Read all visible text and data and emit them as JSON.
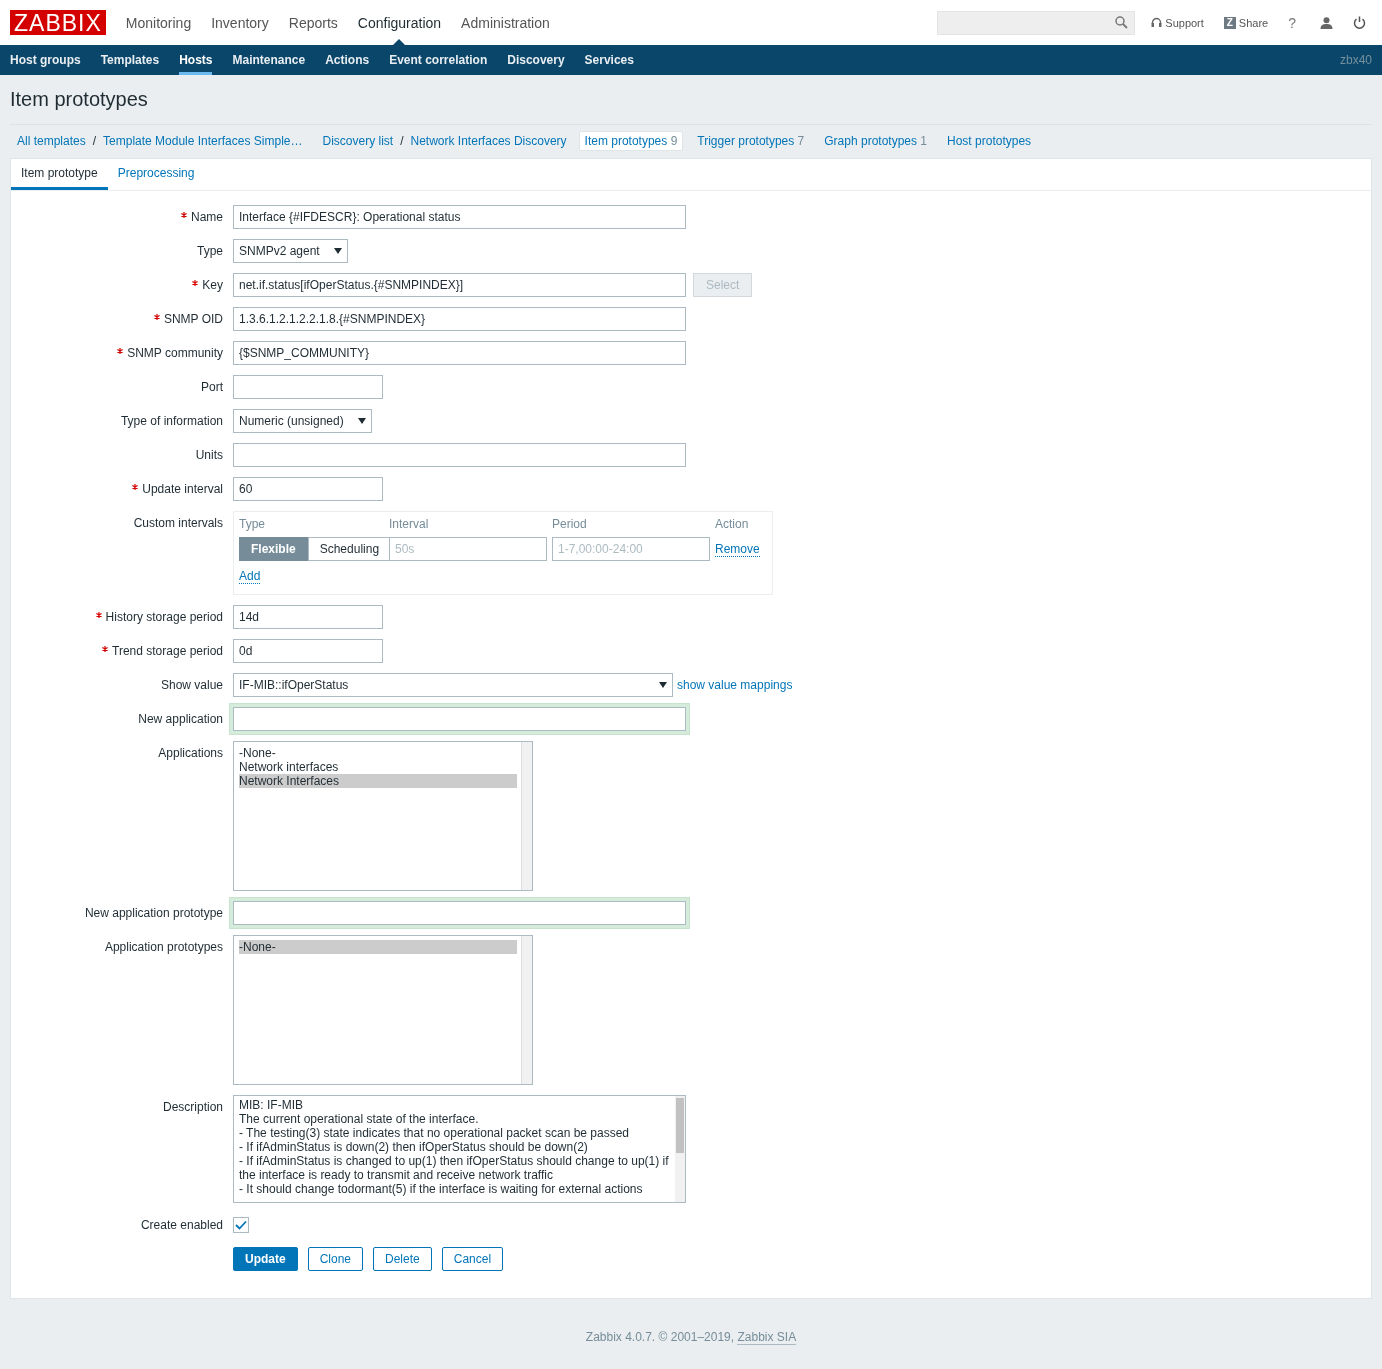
{
  "header": {
    "logo": "ZABBIX",
    "main_menu": [
      {
        "label": "Monitoring",
        "selected": false
      },
      {
        "label": "Inventory",
        "selected": false
      },
      {
        "label": "Reports",
        "selected": false
      },
      {
        "label": "Configuration",
        "selected": true
      },
      {
        "label": "Administration",
        "selected": false
      }
    ],
    "support": "Support",
    "share_badge": "Z",
    "share": "Share",
    "help": "?"
  },
  "sub_menu": {
    "items": [
      {
        "label": "Host groups",
        "selected": false
      },
      {
        "label": "Templates",
        "selected": false
      },
      {
        "label": "Hosts",
        "selected": true
      },
      {
        "label": "Maintenance",
        "selected": false
      },
      {
        "label": "Actions",
        "selected": false
      },
      {
        "label": "Event correlation",
        "selected": false
      },
      {
        "label": "Discovery",
        "selected": false
      },
      {
        "label": "Services",
        "selected": false
      }
    ],
    "server": "zbx40"
  },
  "page_title": "Item prototypes",
  "breadcrumbs": [
    {
      "items": [
        {
          "label": "All templates",
          "separator": "/"
        },
        {
          "label": "Template Module Interfaces Simple…"
        }
      ]
    },
    {
      "items": [
        {
          "label": "Discovery list",
          "separator": "/"
        },
        {
          "label": "Network Interfaces Discovery"
        }
      ]
    }
  ],
  "sections": [
    {
      "label": "Item prototypes",
      "count": "9",
      "selected": true
    },
    {
      "label": "Trigger prototypes",
      "count": "7",
      "selected": false
    },
    {
      "label": "Graph prototypes",
      "count": "1",
      "selected": false
    },
    {
      "label": "Host prototypes",
      "selected": false
    }
  ],
  "form_tabs": [
    {
      "label": "Item prototype",
      "selected": true
    },
    {
      "label": "Preprocessing",
      "selected": false
    }
  ],
  "fields": [
    {
      "kind": "text",
      "label": "Name",
      "required": true,
      "value": "Interface {#IFDESCR}: Operational status"
    },
    {
      "kind": "select",
      "label": "Type",
      "required": false,
      "value": "SNMPv2 agent"
    },
    {
      "kind": "text",
      "label": "Key",
      "required": true,
      "value": "net.if.status[ifOperStatus.{#SNMPINDEX}]",
      "button": {
        "label": "Select",
        "disabled": true
      }
    },
    {
      "kind": "text",
      "label": "SNMP OID",
      "required": true,
      "value": "1.3.6.1.2.1.2.2.1.8.{#SNMPINDEX}"
    },
    {
      "kind": "text",
      "label": "SNMP community",
      "required": true,
      "value": "{$SNMP_COMMUNITY}"
    },
    {
      "kind": "short_text",
      "label": "Port",
      "required": false
    },
    {
      "kind": "select",
      "label": "Type of information",
      "required": false,
      "value": "Numeric (unsigned)"
    },
    {
      "kind": "text",
      "label": "Units",
      "required": false
    },
    {
      "kind": "short_text",
      "label": "Update interval",
      "required": true,
      "value": "60"
    },
    {
      "kind": "intervals",
      "label": "Custom intervals",
      "required": false,
      "columns": [
        "Type",
        "Interval",
        "Period",
        "Action"
      ],
      "rows": [
        {
          "modes": [
            {
              "label": "Flexible",
              "selected": true
            },
            {
              "label": "Scheduling",
              "selected": false
            }
          ],
          "interval_placeholder": "50s",
          "period_placeholder": "1-7,00:00-24:00",
          "action": "Remove"
        }
      ],
      "add": "Add"
    },
    {
      "kind": "short_text",
      "label": "History storage period",
      "required": true,
      "value": "14d"
    },
    {
      "kind": "short_text",
      "label": "Trend storage period",
      "required": true,
      "value": "0d"
    },
    {
      "kind": "select",
      "label": "Show value",
      "required": false,
      "value": "IF-MIB::ifOperStatus",
      "link": "show value mappings"
    },
    {
      "kind": "text",
      "label": "New application",
      "required": false,
      "highlighted": true
    },
    {
      "kind": "listbox",
      "label": "Applications",
      "required": false,
      "options": [
        {
          "label": "-None-",
          "selected": false
        },
        {
          "label": "Network interfaces",
          "selected": false
        },
        {
          "label": "Network Interfaces",
          "selected": true
        }
      ]
    },
    {
      "kind": "text",
      "label": "New application prototype",
      "required": false,
      "highlighted": true
    },
    {
      "kind": "listbox",
      "label": "Application prototypes",
      "required": false,
      "options": [
        {
          "label": "-None-",
          "selected": true
        }
      ]
    },
    {
      "kind": "textarea",
      "label": "Description",
      "required": false,
      "value": "MIB: IF-MIB\nThe current operational state of the interface.\n- The testing(3) state indicates that no operational packet scan be passed\n- If ifAdminStatus is down(2) then ifOperStatus should be down(2)\n- If ifAdminStatus is changed to up(1) then ifOperStatus should change to up(1) if the interface is ready to transmit and receive network traffic\n- It should change todormant(5) if the interface is waiting for external actions"
    },
    {
      "kind": "checkbox",
      "label": "Create enabled",
      "required": false,
      "checked": true
    }
  ],
  "actions": [
    {
      "label": "Update",
      "primary": true
    },
    {
      "label": "Clone",
      "primary": false
    },
    {
      "label": "Delete",
      "primary": false
    },
    {
      "label": "Cancel",
      "primary": false
    }
  ],
  "footer": {
    "text": "Zabbix 4.0.7. © 2001–2019, ",
    "link": "Zabbix SIA"
  }
}
